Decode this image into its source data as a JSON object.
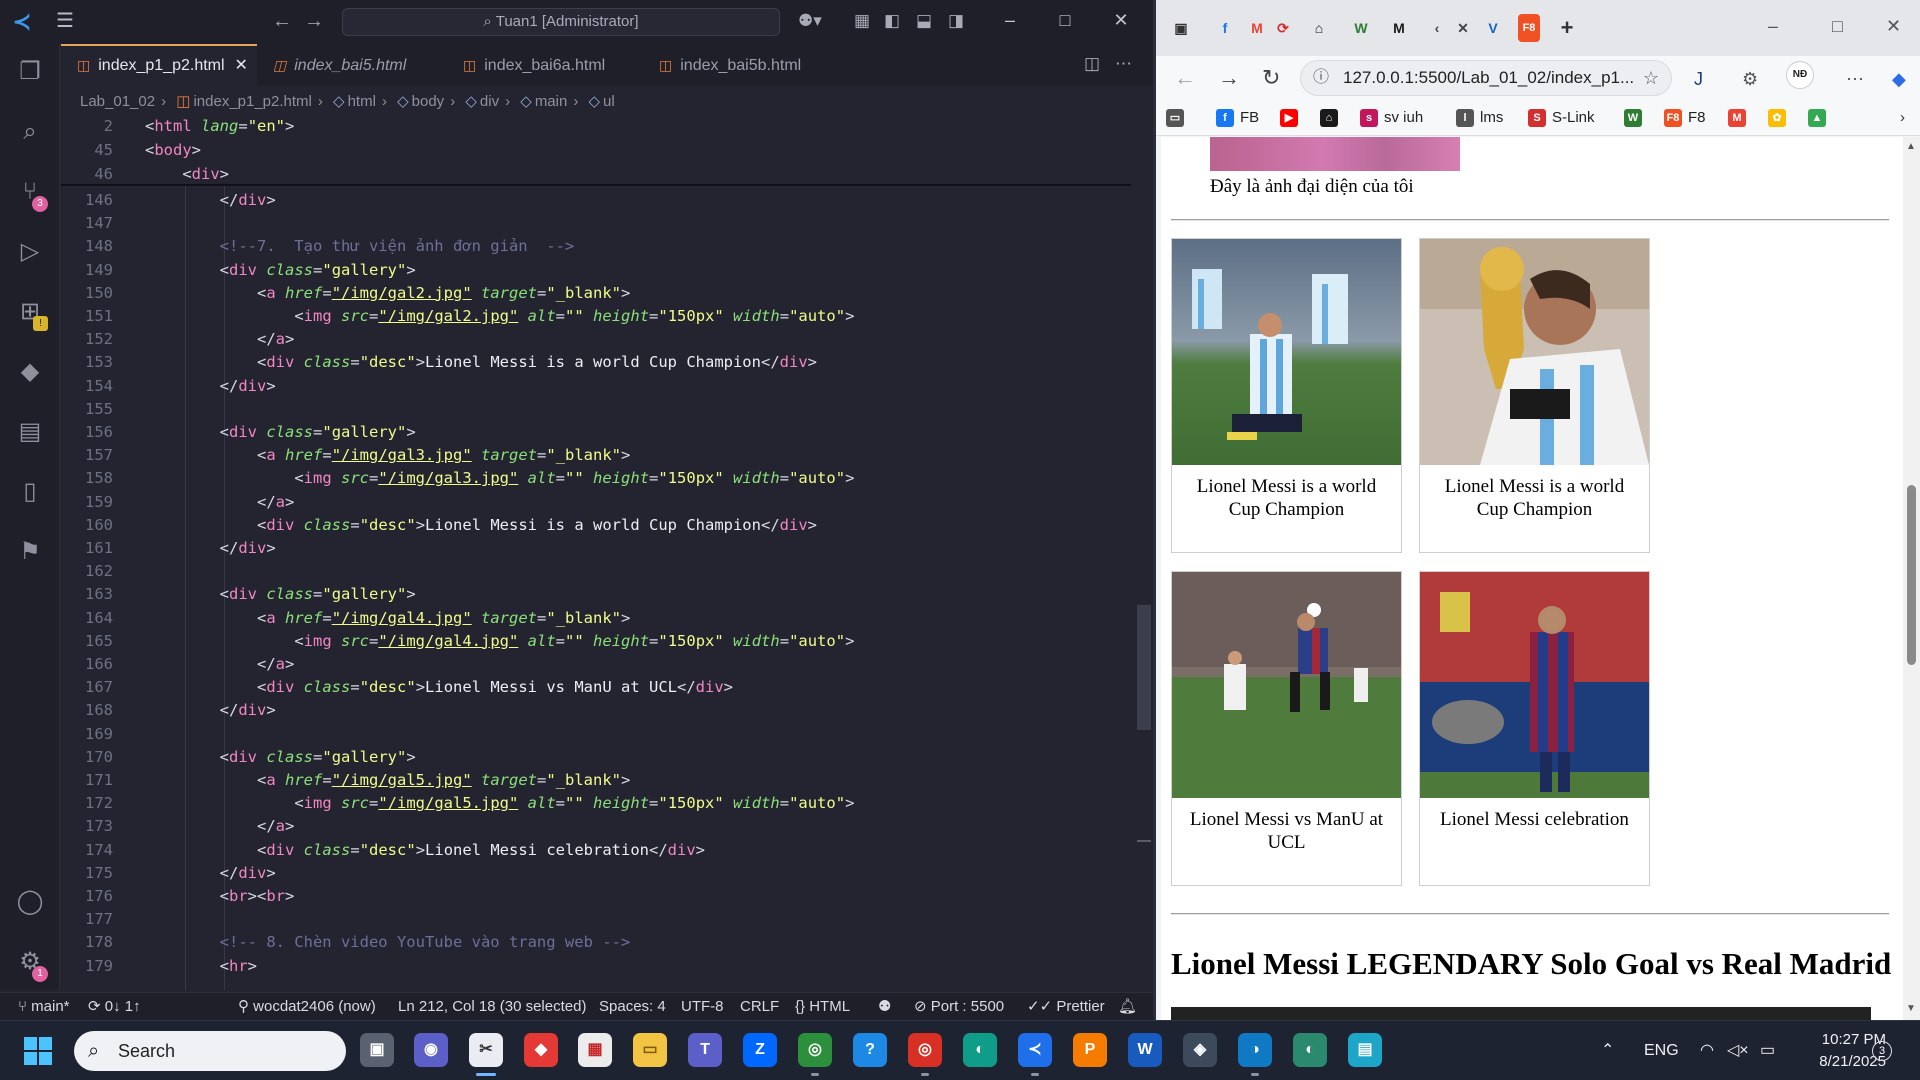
{
  "vscode": {
    "search_title": "Tuan1 [Administrator]",
    "tabs": [
      {
        "label": "index_p1_p2.html",
        "active": true
      },
      {
        "label": "index_bai5.html",
        "active": false
      },
      {
        "label": "index_bai6a.html",
        "active": false
      },
      {
        "label": "index_bai5b.html",
        "active": false
      }
    ],
    "breadcrumb": [
      "Lab_01_02",
      "index_p1_p2.html",
      "html",
      "body",
      "div",
      "main",
      "ul"
    ],
    "activity_badges": {
      "source_control": "3",
      "accounts": "1"
    },
    "sticky_lines": [
      {
        "n": "2",
        "code": "<html lang=\"en\">"
      },
      {
        "n": "45",
        "code": "<body>"
      },
      {
        "n": "46",
        "code": "    <div>"
      }
    ],
    "code_lines": [
      {
        "n": "146",
        "code": "        </div>"
      },
      {
        "n": "147",
        "code": ""
      },
      {
        "n": "148",
        "code": "        <!--7.  Tạo thư viện ảnh đơn giản  -->"
      },
      {
        "n": "149",
        "code": "        <div class=\"gallery\">"
      },
      {
        "n": "150",
        "code": "            <a href=\"/img/gal2.jpg\" target=\"_blank\">"
      },
      {
        "n": "151",
        "code": "                <img src=\"/img/gal2.jpg\" alt=\"\" height=\"150px\" width=\"auto\">"
      },
      {
        "n": "152",
        "code": "            </a>"
      },
      {
        "n": "153",
        "code": "            <div class=\"desc\">Lionel Messi is a world Cup Champion</div>"
      },
      {
        "n": "154",
        "code": "        </div>"
      },
      {
        "n": "155",
        "code": ""
      },
      {
        "n": "156",
        "code": "        <div class=\"gallery\">"
      },
      {
        "n": "157",
        "code": "            <a href=\"/img/gal3.jpg\" target=\"_blank\">"
      },
      {
        "n": "158",
        "code": "                <img src=\"/img/gal3.jpg\" alt=\"\" height=\"150px\" width=\"auto\">"
      },
      {
        "n": "159",
        "code": "            </a>"
      },
      {
        "n": "160",
        "code": "            <div class=\"desc\">Lionel Messi is a world Cup Champion</div>"
      },
      {
        "n": "161",
        "code": "        </div>"
      },
      {
        "n": "162",
        "code": ""
      },
      {
        "n": "163",
        "code": "        <div class=\"gallery\">"
      },
      {
        "n": "164",
        "code": "            <a href=\"/img/gal4.jpg\" target=\"_blank\">"
      },
      {
        "n": "165",
        "code": "                <img src=\"/img/gal4.jpg\" alt=\"\" height=\"150px\" width=\"auto\">"
      },
      {
        "n": "166",
        "code": "            </a>"
      },
      {
        "n": "167",
        "code": "            <div class=\"desc\">Lionel Messi vs ManU at UCL</div>"
      },
      {
        "n": "168",
        "code": "        </div>"
      },
      {
        "n": "169",
        "code": ""
      },
      {
        "n": "170",
        "code": "        <div class=\"gallery\">"
      },
      {
        "n": "171",
        "code": "            <a href=\"/img/gal5.jpg\" target=\"_blank\">"
      },
      {
        "n": "172",
        "code": "                <img src=\"/img/gal5.jpg\" alt=\"\" height=\"150px\" width=\"auto\">"
      },
      {
        "n": "173",
        "code": "            </a>"
      },
      {
        "n": "174",
        "code": "            <div class=\"desc\">Lionel Messi celebration</div>"
      },
      {
        "n": "175",
        "code": "        </div>"
      },
      {
        "n": "176",
        "code": "        <br><br>"
      },
      {
        "n": "177",
        "code": ""
      },
      {
        "n": "178",
        "code": "        <!-- 8. Chèn video YouTube vào trang web -->"
      },
      {
        "n": "179",
        "code": "        <hr>"
      }
    ],
    "status": {
      "branch": "main*",
      "sync": "0↓ 1↑",
      "author": "wocdat2406 (now)",
      "cursor": "Ln 212, Col 18 (30 selected)",
      "spaces": "Spaces: 4",
      "encoding": "UTF-8",
      "eol": "CRLF",
      "language": "HTML",
      "port": "Port : 5500",
      "prettier": "Prettier"
    }
  },
  "browser": {
    "url": "127.0.0.1:5500/Lab_01_02/index_p1...",
    "avatar": "NĐ",
    "bookmarks": [
      {
        "label": "FB",
        "icon": "f",
        "color": "#1877f2"
      },
      {
        "label": "",
        "icon": "▶",
        "color": "#ff0000"
      },
      {
        "label": "",
        "icon": "⌂",
        "color": "#1a1a1a"
      },
      {
        "label": "sv iuh",
        "icon": "s",
        "color": "#c2185b"
      },
      {
        "label": "lms",
        "icon": "l",
        "color": "#555555"
      },
      {
        "label": "S-Link",
        "icon": "S",
        "color": "#d32f2f"
      },
      {
        "label": "",
        "icon": "W",
        "color": "#2e7d32"
      },
      {
        "label": "F8",
        "icon": "F8",
        "color": "#f05123"
      },
      {
        "label": "",
        "icon": "M",
        "color": "#ea4335"
      },
      {
        "label": "",
        "icon": "✿",
        "color": "#fbbc04"
      },
      {
        "label": "",
        "icon": "▲",
        "color": "#34a853"
      }
    ],
    "page": {
      "avatar_caption": "Đây là ảnh đại diện của tôi",
      "gallery": [
        {
          "desc": "Lionel Messi is a world Cup Champion"
        },
        {
          "desc": "Lionel Messi is a world Cup Champion"
        },
        {
          "desc": "Lionel Messi vs ManU at UCL"
        },
        {
          "desc": "Lionel Messi celebration"
        }
      ],
      "video_heading": "Lionel Messi LEGENDARY Solo Goal vs Real Madrid"
    }
  },
  "taskbar": {
    "search_placeholder": "Search",
    "language": "ENG",
    "time": "10:27 PM",
    "date": "8/21/2025",
    "notifications": "3"
  }
}
